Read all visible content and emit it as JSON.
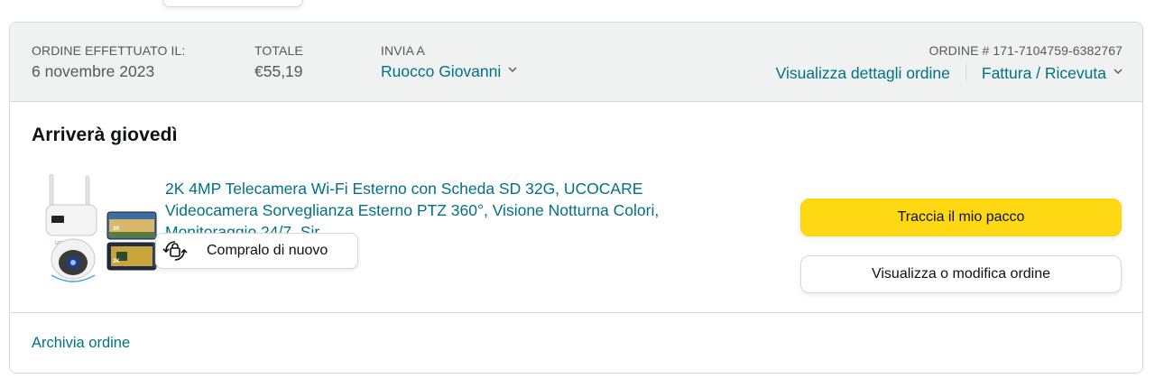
{
  "header": {
    "placed_label": "ORDINE EFFETTUATO IL:",
    "placed_date": "6 novembre 2023",
    "total_label": "TOTALE",
    "total_value": "€55,19",
    "ship_to_label": "INVIA A",
    "ship_to_name": "Ruocco Giovanni",
    "order_number": "ORDINE # 171-7104759-6382767",
    "details_link": "Visualizza dettagli ordine",
    "invoice_link": "Fattura / Ricevuta"
  },
  "body": {
    "status": "Arriverà giovedì",
    "product_title": "2K 4MP Telecamera Wi-Fi Esterno con Scheda SD 32G, UCOCARE Videocamera Sorveglianza Esterno PTZ 360°, Visione Notturna Colori, Monitoraggio 24/7, Sir",
    "buy_again_label": "Compralo di nuovo",
    "track_button": "Traccia il mio pacco",
    "view_button": "Visualizza o modifica ordine"
  },
  "footer": {
    "archive_link": "Archivia ordine"
  },
  "colors": {
    "link": "#007185",
    "primary_button": "#ffd814",
    "header_bg": "#f0f2f2"
  },
  "icons": [
    "chevron-down-icon",
    "buy-again-icon"
  ]
}
